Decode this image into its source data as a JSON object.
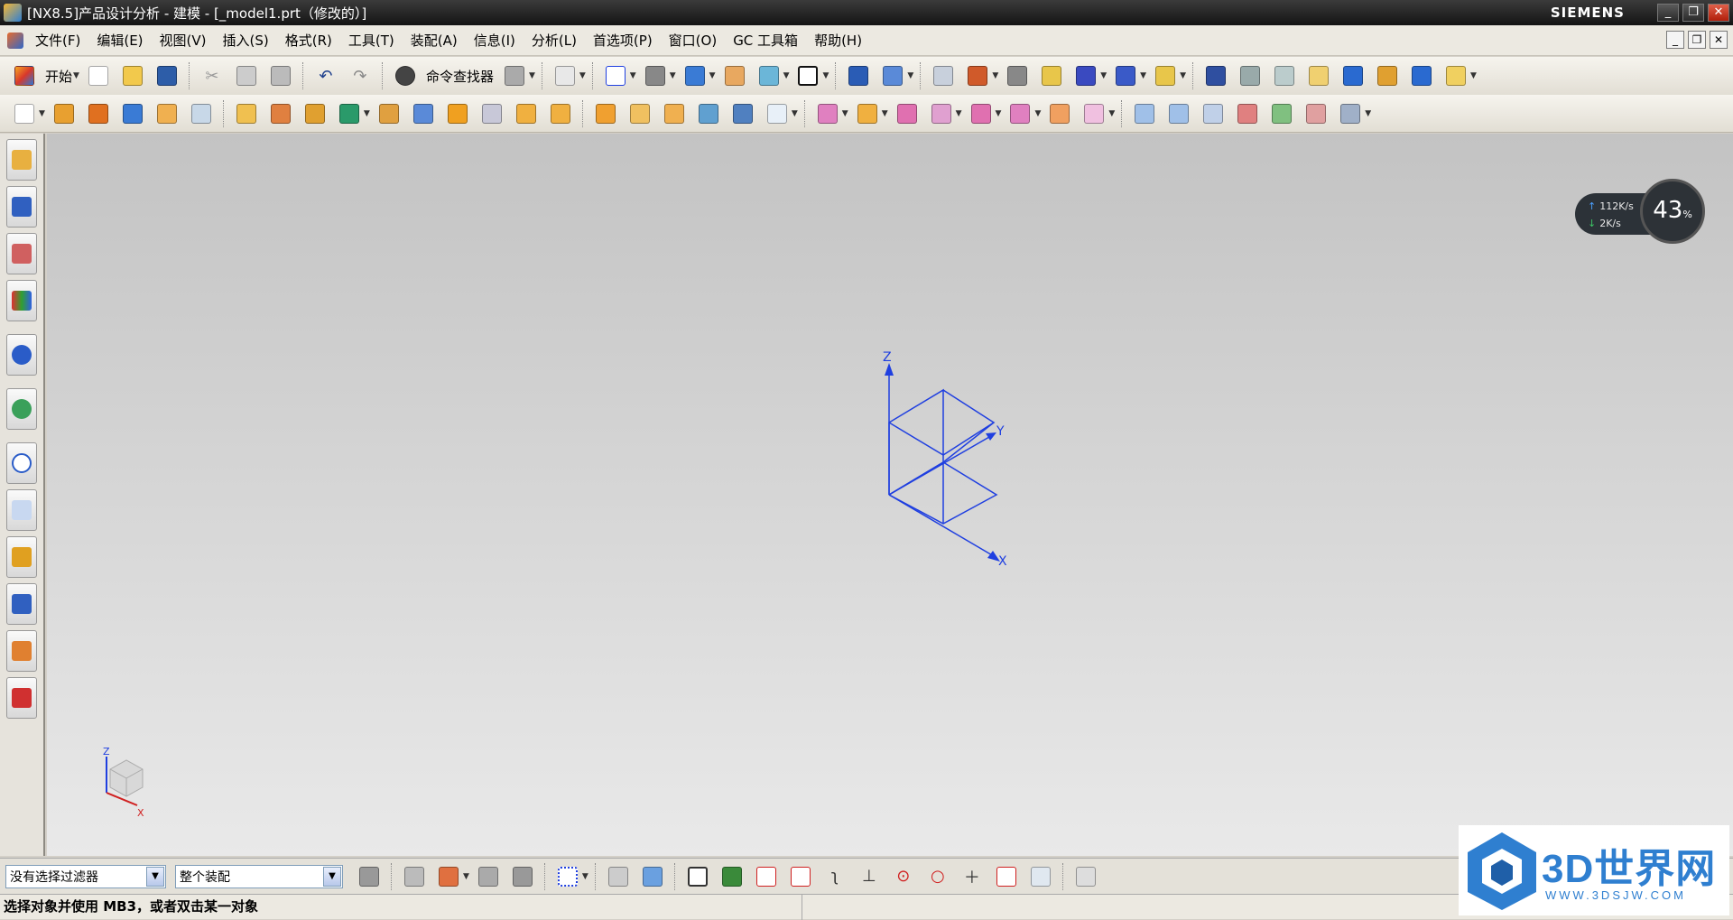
{
  "window": {
    "title": "[NX8.5]产品设计分析 - 建模 - [_model1.prt（修改的）]",
    "brand": "SIEMENS"
  },
  "menu": [
    "文件(F)",
    "编辑(E)",
    "视图(V)",
    "插入(S)",
    "格式(R)",
    "工具(T)",
    "装配(A)",
    "信息(I)",
    "分析(L)",
    "首选项(P)",
    "窗口(O)",
    "GC 工具箱",
    "帮助(H)"
  ],
  "toolbar": {
    "start_label": "开始",
    "command_finder_label": "命令查找器"
  },
  "viewport": {
    "axis_labels": {
      "z": "Z",
      "y": "Y",
      "x": "X"
    },
    "mini_axis": {
      "z": "Z",
      "x": "X"
    }
  },
  "network_widget": {
    "upload": "112K/s",
    "download": "2K/s",
    "percent": "43",
    "percent_unit": "%"
  },
  "filter": {
    "selection_filter": "没有选择过滤器",
    "scope": "整个装配"
  },
  "status": {
    "message": "选择对象并使用 MB3，或者双击某一对象"
  },
  "watermark": {
    "brand": "3D世界网",
    "url": "WWW.3DSJW.COM"
  },
  "colors": {
    "accent_blue": "#1f3fe0",
    "titlebar": "#1e1e1e",
    "viewport_top": "#c3c3c3",
    "viewport_bottom": "#e9e9e9"
  }
}
